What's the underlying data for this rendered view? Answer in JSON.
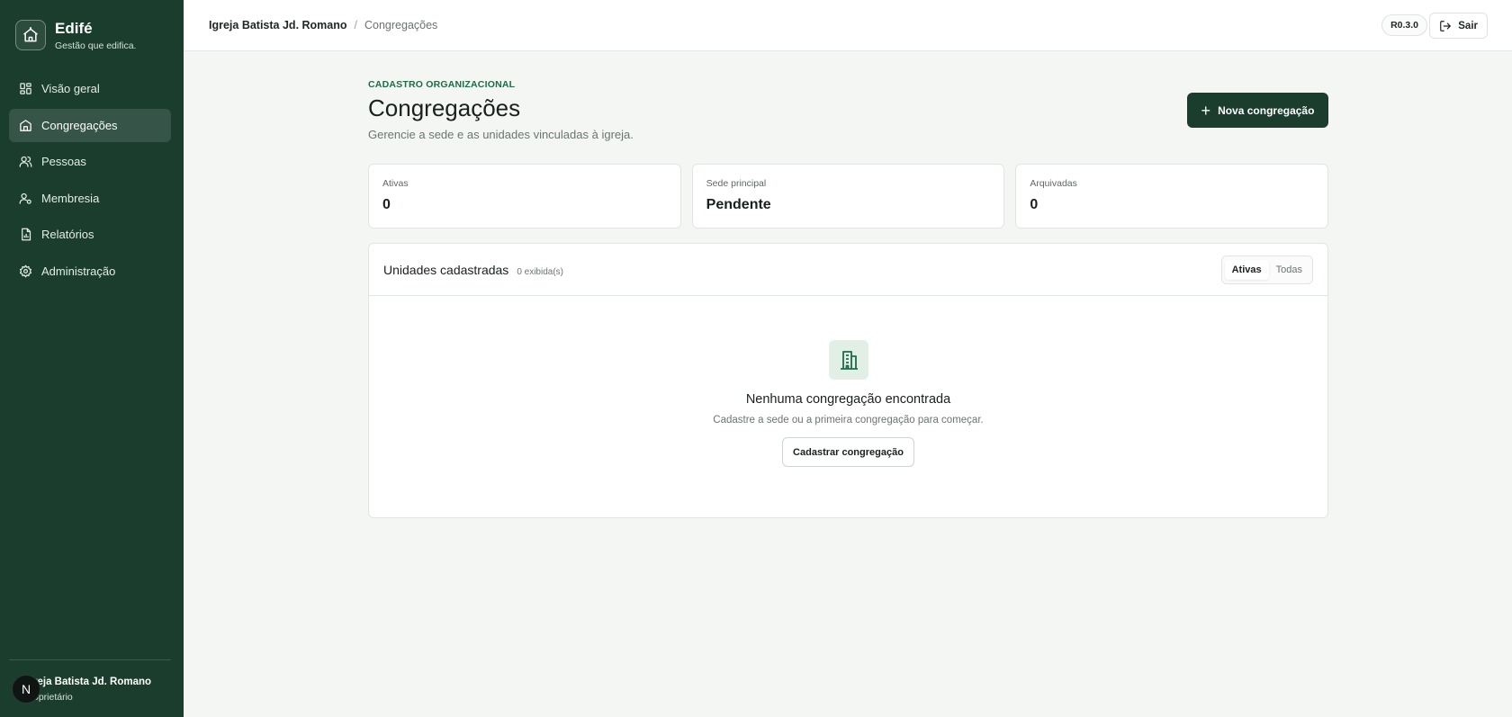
{
  "brand": {
    "name": "Edifé",
    "tagline": "Gestão que edifica."
  },
  "sidebar": {
    "items": [
      {
        "label": "Visão geral",
        "icon": "grid-icon"
      },
      {
        "label": "Congregações",
        "icon": "building-icon",
        "active": true
      },
      {
        "label": "Pessoas",
        "icon": "users-icon"
      },
      {
        "label": "Membresia",
        "icon": "user-check-icon"
      },
      {
        "label": "Relatórios",
        "icon": "report-icon"
      },
      {
        "label": "Administração",
        "icon": "gear-icon"
      }
    ],
    "user": {
      "avatar_letter": "N",
      "name": "reja Batista Jd. Romano",
      "role": "oprietário"
    }
  },
  "topbar": {
    "breadcrumb": {
      "org": "Igreja Batista Jd. Romano",
      "separator": "/",
      "current": "Congregações"
    },
    "version": "R0.3.0",
    "logout_label": "Sair"
  },
  "page": {
    "eyebrow": "CADASTRO ORGANIZACIONAL",
    "title": "Congregações",
    "description": "Gerencie a sede e as unidades vinculadas à igreja.",
    "primary_button": "Nova congregação"
  },
  "stats": [
    {
      "label": "Ativas",
      "value": "0"
    },
    {
      "label": "Sede principal",
      "value": "Pendente"
    },
    {
      "label": "Arquivadas",
      "value": "0"
    }
  ],
  "units": {
    "title": "Unidades cadastradas",
    "count": "0 exibida(s)",
    "filters": [
      "Ativas",
      "Todas"
    ],
    "active_filter": "Ativas",
    "empty_title": "Nenhuma congregação encontrada",
    "empty_desc": "Cadastre a sede ou a primeira congregação para começar.",
    "empty_button": "Cadastrar congregação"
  },
  "colors": {
    "sidebar_bg": "#1b3d2e",
    "accent": "#1f6b49",
    "primary_button": "#1b3d2e"
  }
}
